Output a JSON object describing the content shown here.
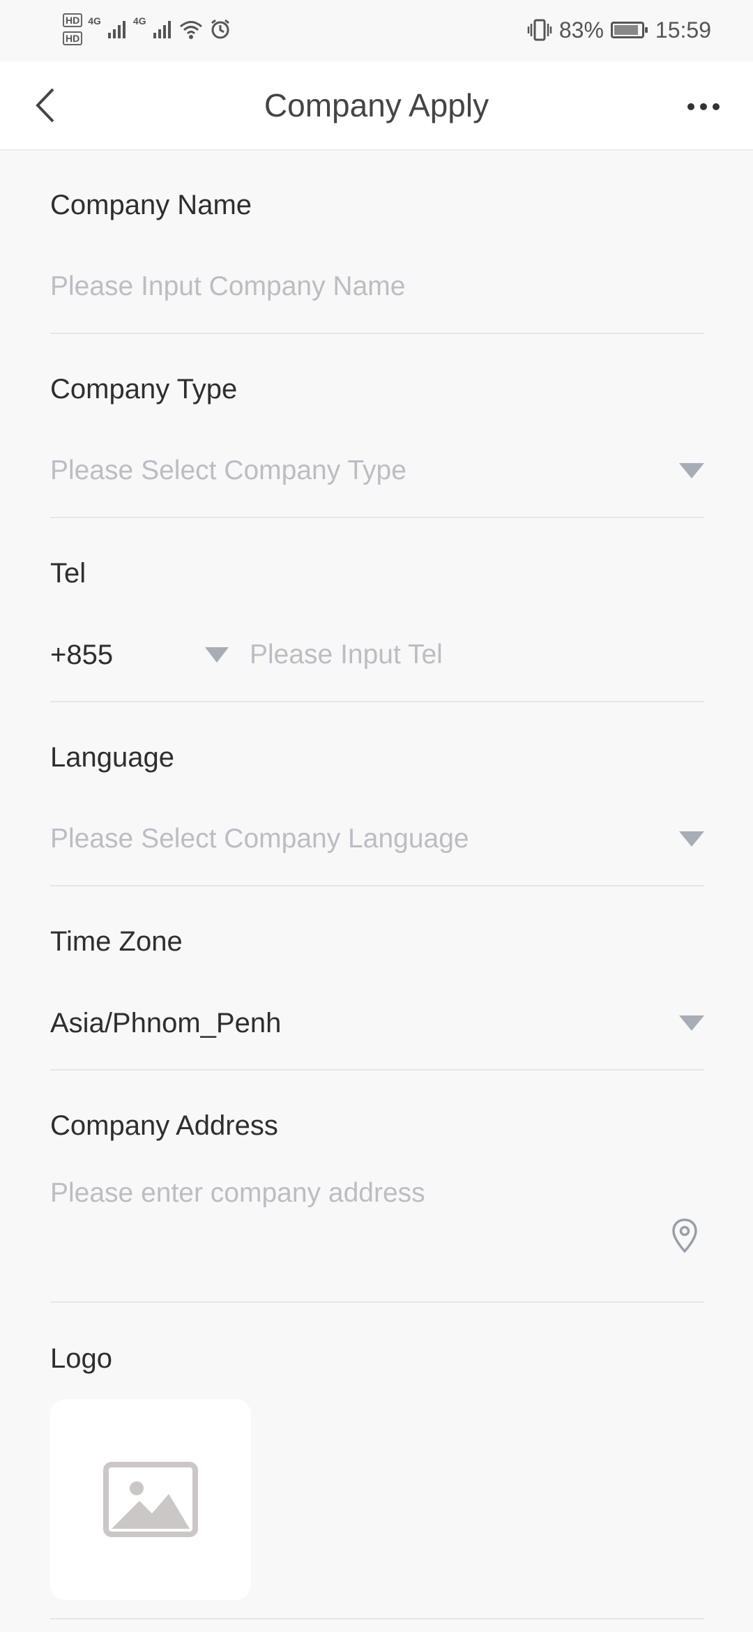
{
  "status_bar": {
    "hd1": "HD",
    "hd2": "HD",
    "net1": "4G",
    "net2": "4G",
    "battery_pct": "83%",
    "time": "15:59"
  },
  "header": {
    "title": "Company Apply"
  },
  "form": {
    "company_name": {
      "label": "Company Name",
      "placeholder": "Please Input Company Name"
    },
    "company_type": {
      "label": "Company Type",
      "placeholder": "Please Select Company Type"
    },
    "tel": {
      "label": "Tel",
      "code": "+855",
      "placeholder": "Please Input Tel"
    },
    "language": {
      "label": "Language",
      "placeholder": "Please Select Company Language"
    },
    "time_zone": {
      "label": "Time Zone",
      "value": "Asia/Phnom_Penh"
    },
    "address": {
      "label": "Company Address",
      "placeholder": "Please enter company address"
    },
    "logo": {
      "label": "Logo"
    }
  },
  "colors": {
    "background": "#f8f8f8",
    "header_bg": "#ffffff",
    "placeholder": "#bcbcc4",
    "caret": "#a7acb5",
    "divider": "#e6e6e6"
  },
  "icons": [
    "back-arrow-icon",
    "more-dots-icon",
    "dropdown-caret-icon",
    "location-pin-icon",
    "image-placeholder-icon"
  ]
}
